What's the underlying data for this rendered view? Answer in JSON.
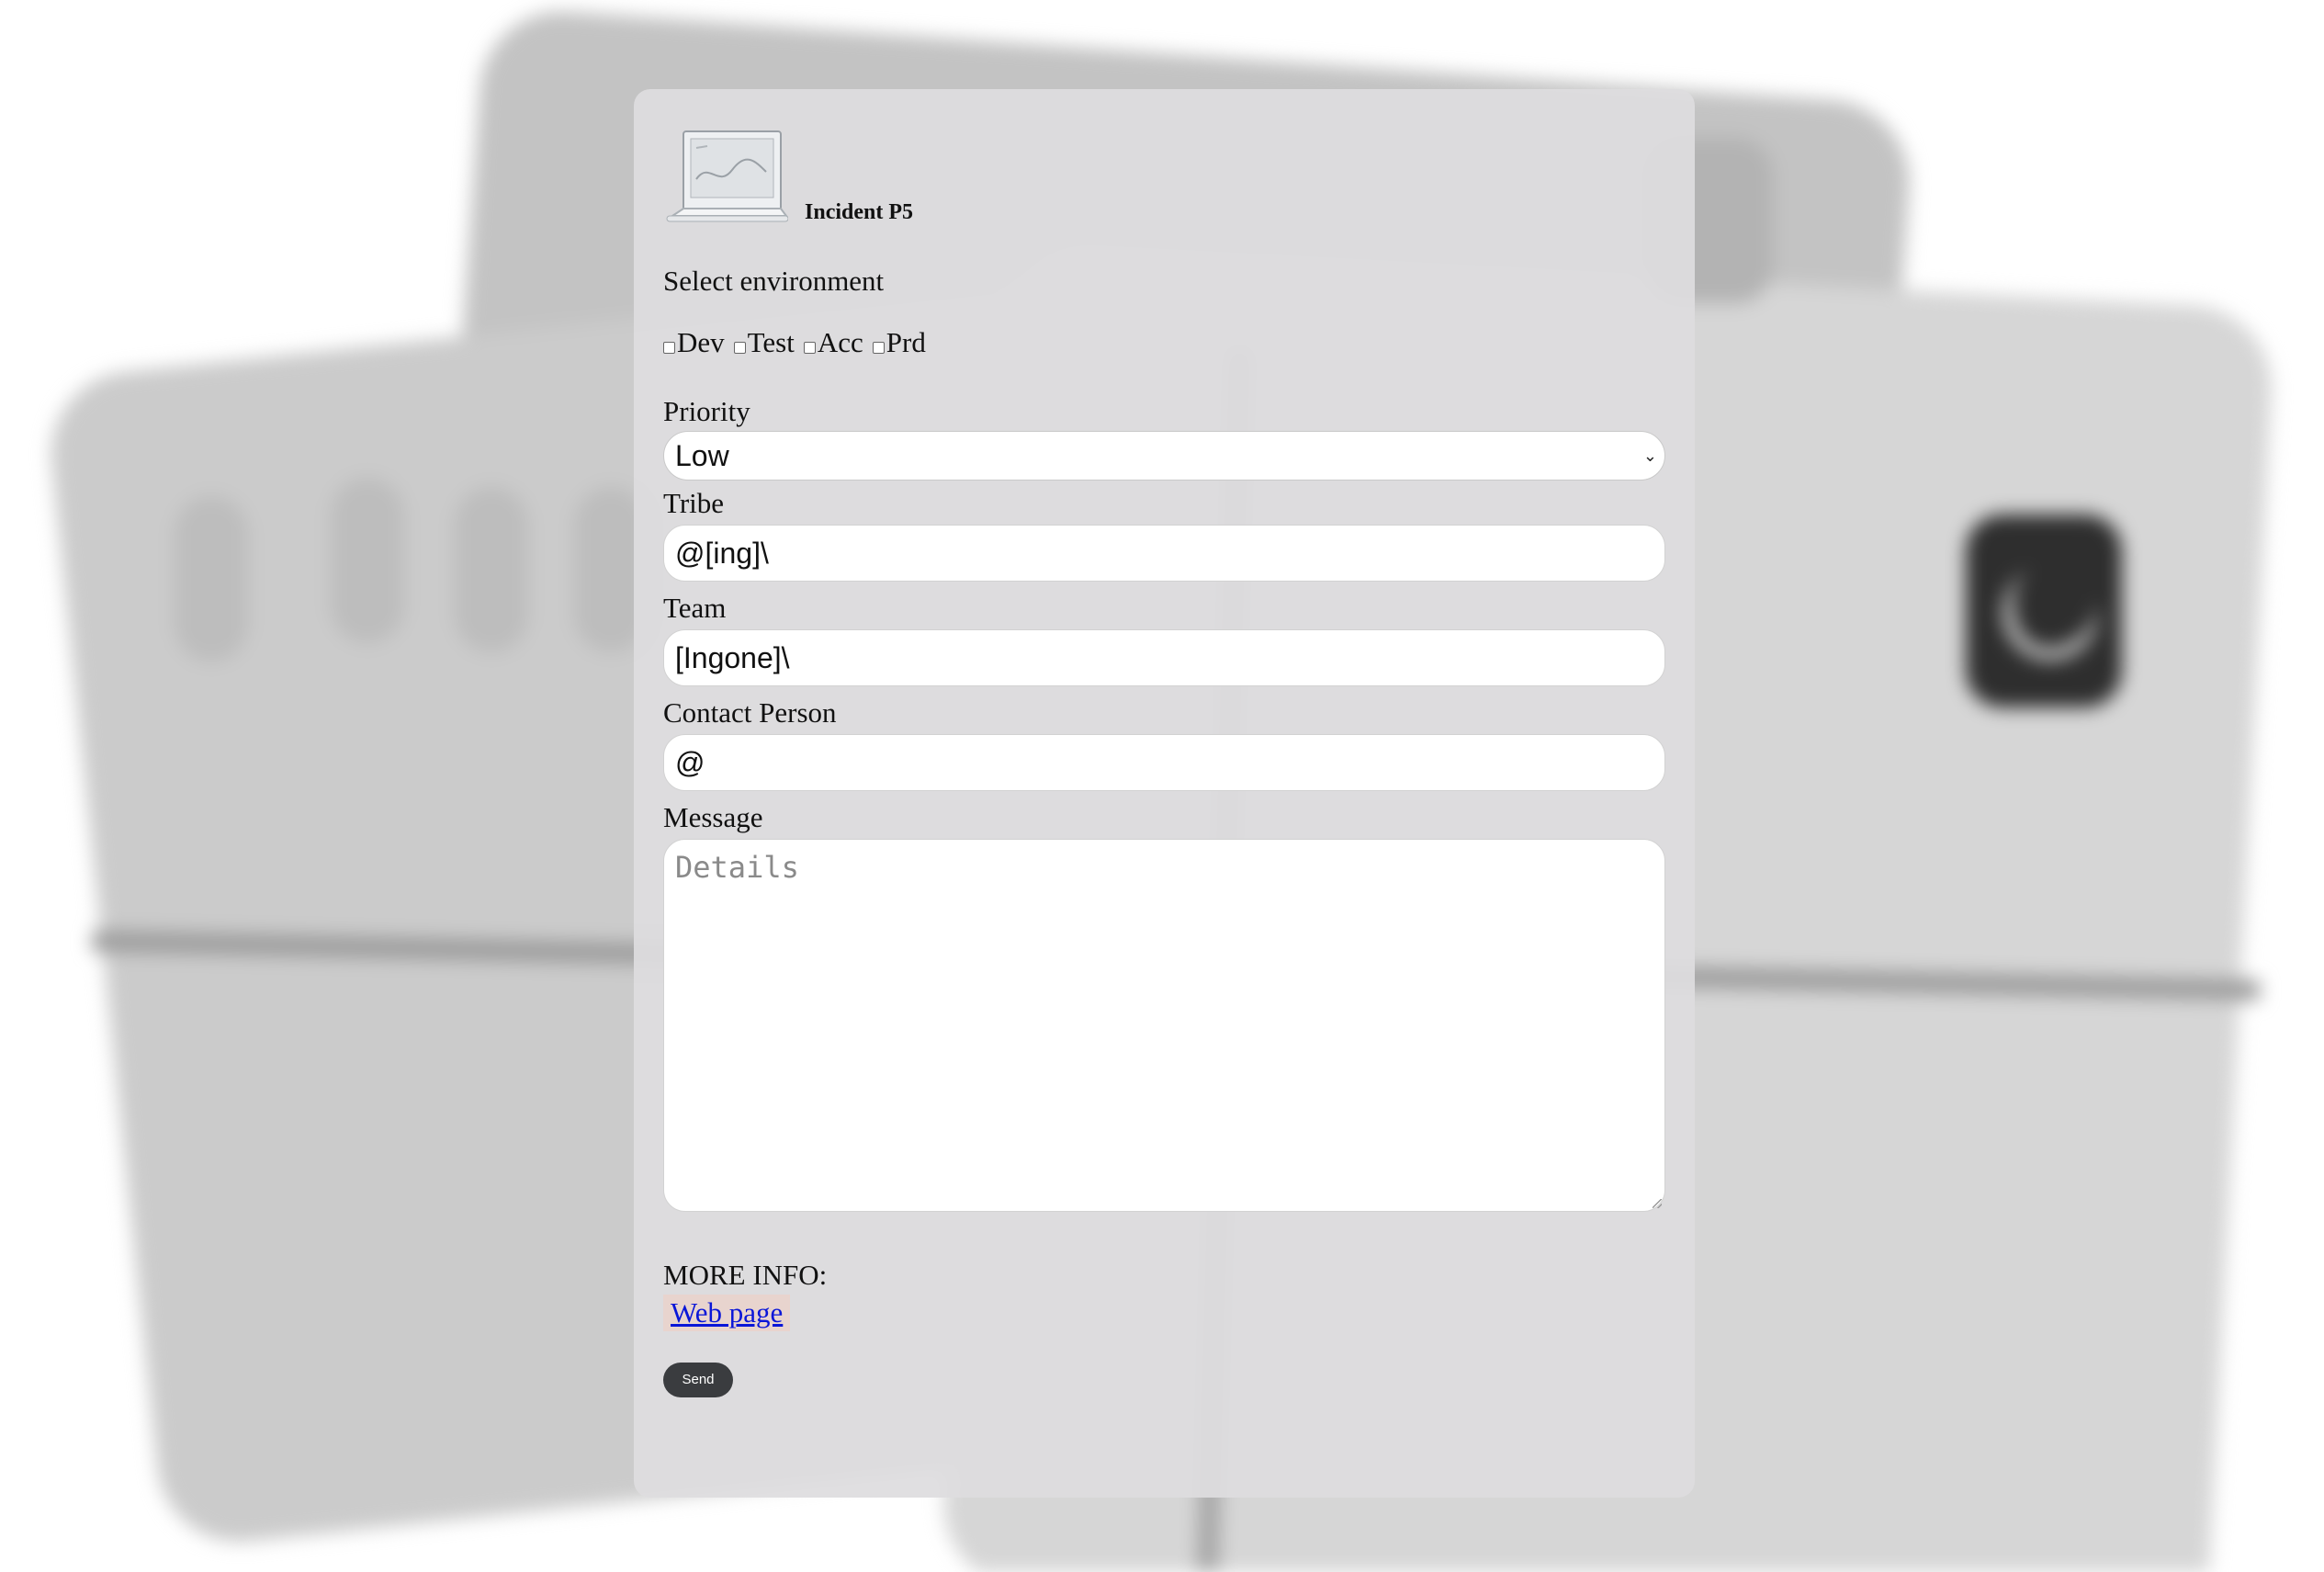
{
  "app": {
    "title": "Incident P5"
  },
  "environment": {
    "heading": "Select environment",
    "options": [
      {
        "label": "Dev",
        "checked": false
      },
      {
        "label": "Test",
        "checked": false
      },
      {
        "label": "Acc",
        "checked": false
      },
      {
        "label": "Prd",
        "checked": false
      }
    ]
  },
  "priority": {
    "label": "Priority",
    "selected": "Low"
  },
  "tribe": {
    "label": "Tribe",
    "value": "@[ing]\\"
  },
  "team": {
    "label": "Team",
    "value": "[Ingone]\\"
  },
  "contact": {
    "label": "Contact Person",
    "value": "@"
  },
  "message": {
    "label": "Message",
    "placeholder": "Details"
  },
  "more_info": {
    "label": "MORE INFO:",
    "link_text": "Web page"
  },
  "actions": {
    "send_label": "Send"
  },
  "colors": {
    "panel": "#dedddf",
    "send_button": "#3a3c3f",
    "link": "#0a16d8"
  }
}
